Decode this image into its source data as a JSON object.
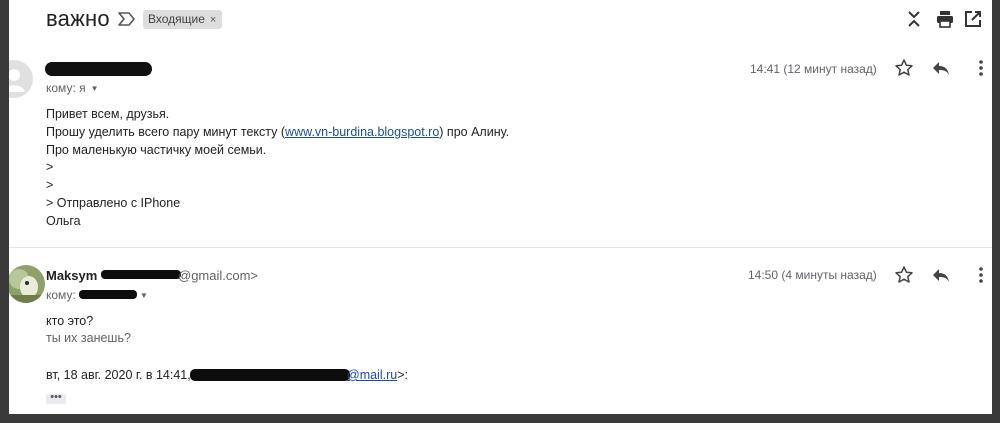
{
  "subject": "важно",
  "label": {
    "text": "Входящие",
    "close": "×"
  },
  "messages": [
    {
      "timestamp": "14:41 (12 минут назад)",
      "to_label": "кому: я",
      "body": [
        "Привет всем, друзья.",
        "Прошу уделить всего пару минут тексту (",
        "www.vn-burdina.blogspot.ro",
        ") про Алину.",
        "Про маленькую частичку моей семьи.",
        ">",
        ">",
        "> Отправлено с IPhone",
        "Ольга"
      ]
    },
    {
      "sender_name": "Maksym",
      "sender_email_suffix": "@gmail.com>",
      "timestamp": "14:50 (4 минуты назад)",
      "to_label": "кому:",
      "body": [
        "кто это?",
        "ты их занешь?"
      ],
      "quote_prefix": "вт, 18 авг. 2020 г. в 14:41,",
      "quote_email_suffix": "@mail.ru",
      "quote_end": ">:",
      "ellipsis": "•••"
    }
  ],
  "icons": {
    "importance": "importance-marker-icon",
    "collapse": "collapse-all-icon",
    "print": "print-icon",
    "new_window": "open-in-new-window-icon",
    "star": "star-icon",
    "reply": "reply-icon",
    "more": "more-vert-icon"
  }
}
